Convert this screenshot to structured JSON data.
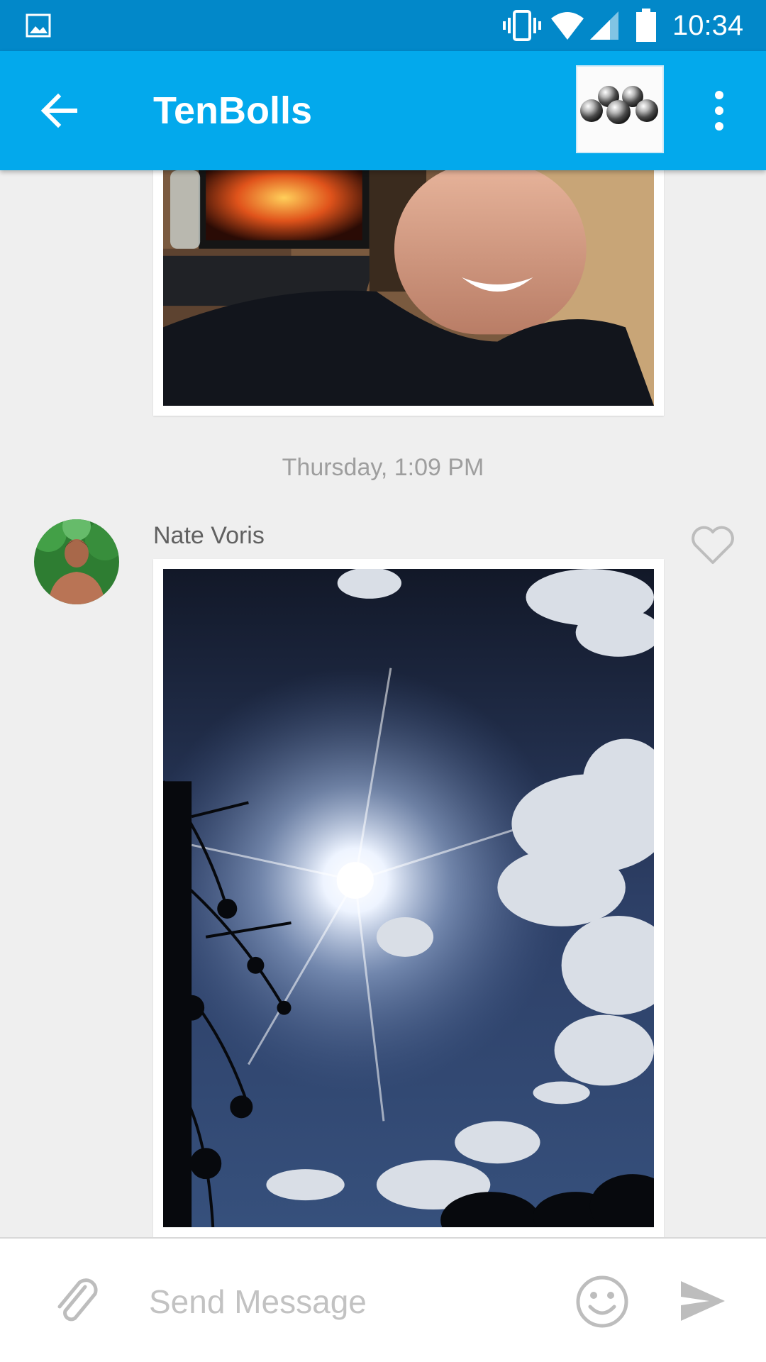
{
  "status_bar": {
    "time": "10:34",
    "icons": [
      "gallery-icon",
      "vibrate-icon",
      "wifi-icon",
      "signal-icon",
      "battery-icon"
    ],
    "color": "#0288c9"
  },
  "app_bar": {
    "title": "TenBolls",
    "color": "#03a9ec",
    "back_icon": "arrow-left-icon",
    "menu_icon": "more-vert-icon"
  },
  "feed": {
    "messages": [
      {
        "type": "photo",
        "subject": "selfie"
      },
      {
        "timestamp": "Thursday, 1:09 PM",
        "sender": "Nate Voris",
        "type": "photo",
        "subject": "sun-and-clouds",
        "liked": false
      }
    ]
  },
  "composer": {
    "placeholder": "Send Message",
    "value": "",
    "attach_icon": "paperclip-icon",
    "emoji_icon": "smiley-icon",
    "send_icon": "send-icon"
  }
}
